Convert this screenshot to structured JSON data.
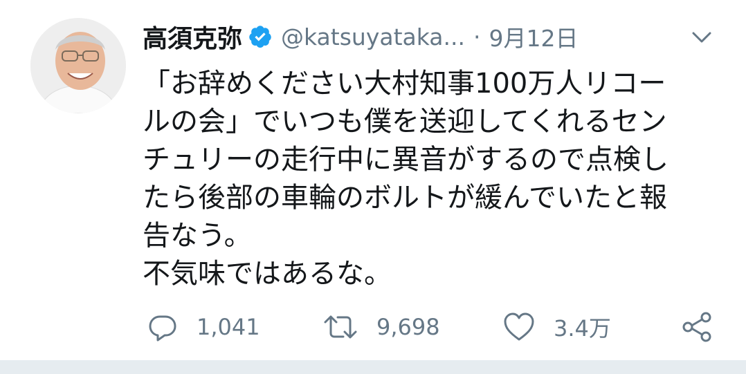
{
  "tweet": {
    "display_name": "高須克弥",
    "handle": "@katsuyataka...",
    "separator": "·",
    "date": "9月12日",
    "verified": true,
    "icons": {
      "verified": "verified-badge-icon",
      "menu": "chevron-down-icon",
      "reply": "reply-icon",
      "retweet": "retweet-icon",
      "like": "heart-icon",
      "share": "share-icon"
    },
    "text_lines": [
      "「お辞めください大村知事100万人リコー",
      "ルの会」でいつも僕を送迎してくれるセン",
      "チュリーの走行中に異音がするので点検し",
      "たら後部の車輪のボルトが緩んでいたと報",
      "告なう。",
      "不気味ではあるな。"
    ],
    "actions": {
      "reply_count": "1,041",
      "retweet_count": "9,698",
      "like_count": "3.4万"
    },
    "colors": {
      "text": "#14171a",
      "secondary": "#657786",
      "verified": "#1da1f2",
      "divider": "#e6ecf0"
    }
  }
}
